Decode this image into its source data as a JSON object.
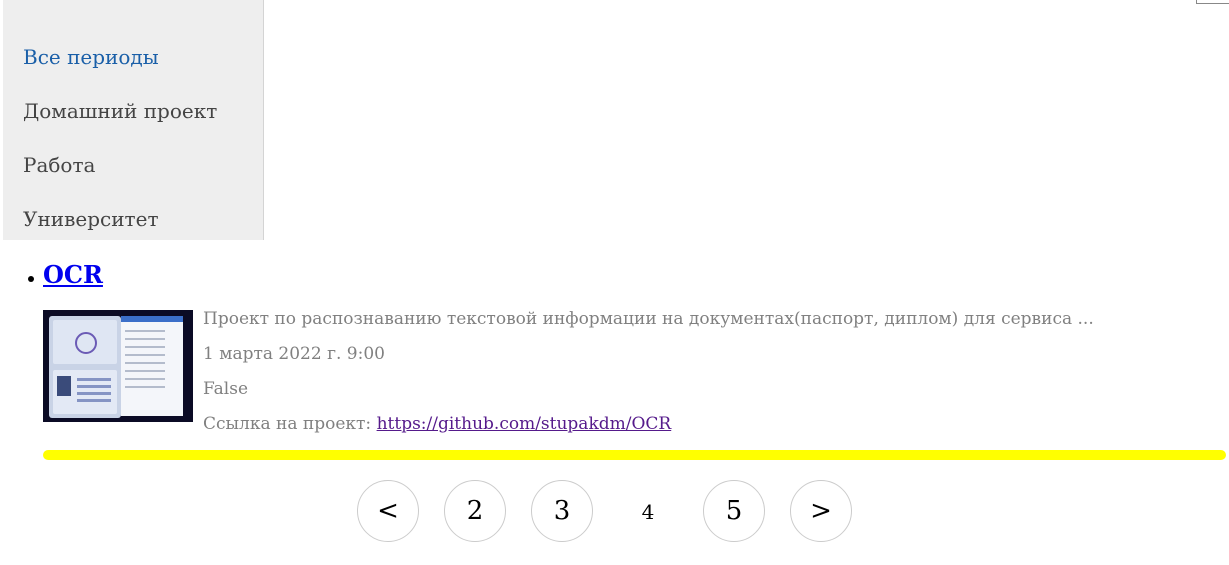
{
  "sidebar": {
    "items": [
      {
        "label": "Все периоды",
        "active": true
      },
      {
        "label": "Домашний проект",
        "active": false
      },
      {
        "label": "Работа",
        "active": false
      },
      {
        "label": "Университет",
        "active": false
      }
    ]
  },
  "post": {
    "title": "OCR",
    "thumbnail_icon": "project-thumbnail-image",
    "description": "Проект по распознаванию текстовой информации на документах(паспорт, диплом) для сервиса ...",
    "date": "1 марта 2022 г. 9:00",
    "flag": "False",
    "link_label": "Ссылка на проект:",
    "link_url": "https://github.com/stupakdm/OCR"
  },
  "colors": {
    "divider": "#ffff00",
    "active_link": "#1a5fa8",
    "visited_link": "#551a8b"
  },
  "pagination": {
    "prev": "<",
    "pages": [
      "2",
      "3"
    ],
    "current": "4",
    "after": [
      "5"
    ],
    "next": ">"
  }
}
